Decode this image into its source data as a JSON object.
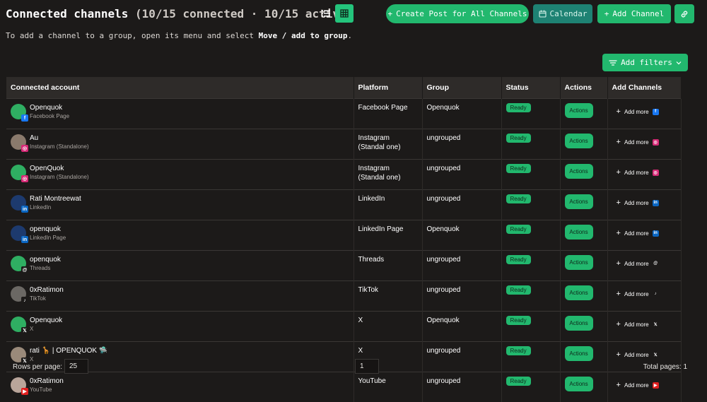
{
  "header": {
    "title": "Connected channels",
    "counts": "(10/15 connected · 10/15 active)",
    "create_post_label": "Create Post for All Channels",
    "calendar_label": "Calendar",
    "add_channel_label": "Add Channel"
  },
  "hint": {
    "prefix": "To add a channel to a group, open its menu and select ",
    "emphasis": "Move / add to group",
    "suffix": "."
  },
  "filters": {
    "label": "Add filters"
  },
  "table": {
    "columns": [
      "Connected account",
      "Platform",
      "Group",
      "Status",
      "Actions",
      "Add Channels"
    ],
    "rows": [
      {
        "name": "Openquok",
        "sub": "Facebook Page",
        "platform": "Facebook Page",
        "group": "Openquok",
        "status": "Ready",
        "action": "Actions",
        "add": "Add more",
        "platform_icon": "facebook-icon"
      },
      {
        "name": "Au",
        "sub": "Instagram (Standalone)",
        "platform": "Instagram (Standal one)",
        "group": "ungrouped",
        "status": "Ready",
        "action": "Actions",
        "add": "Add more",
        "platform_icon": "instagram-icon"
      },
      {
        "name": "OpenQuok",
        "sub": "Instagram (Standalone)",
        "platform": "Instagram (Standal one)",
        "group": "ungrouped",
        "status": "Ready",
        "action": "Actions",
        "add": "Add more",
        "platform_icon": "instagram-icon"
      },
      {
        "name": "Rati Montreewat",
        "sub": "LinkedIn",
        "platform": "LinkedIn",
        "group": "ungrouped",
        "status": "Ready",
        "action": "Actions",
        "add": "Add more",
        "platform_icon": "linkedin-icon"
      },
      {
        "name": "openquok",
        "sub": "LinkedIn Page",
        "platform": "LinkedIn Page",
        "group": "Openquok",
        "status": "Ready",
        "action": "Actions",
        "add": "Add more",
        "platform_icon": "linkedin-icon"
      },
      {
        "name": "openquok",
        "sub": "Threads",
        "platform": "Threads",
        "group": "ungrouped",
        "status": "Ready",
        "action": "Actions",
        "add": "Add more",
        "platform_icon": "threads-icon"
      },
      {
        "name": "0xRatimon",
        "sub": "TikTok",
        "platform": "TikTok",
        "group": "ungrouped",
        "status": "Ready",
        "action": "Actions",
        "add": "Add more",
        "platform_icon": "tiktok-icon"
      },
      {
        "name": "Openquok",
        "sub": "X",
        "platform": "X",
        "group": "Openquok",
        "status": "Ready",
        "action": "Actions",
        "add": "Add more",
        "platform_icon": "x-icon"
      },
      {
        "name": "rati 🦒 | OPENQUOK 🛸",
        "sub": "X",
        "platform": "X",
        "group": "ungrouped",
        "status": "Ready",
        "action": "Actions",
        "add": "Add more",
        "platform_icon": "x-icon"
      },
      {
        "name": "0xRatimon",
        "sub": "YouTube",
        "platform": "YouTube",
        "group": "ungrouped",
        "status": "Ready",
        "action": "Actions",
        "add": "Add more",
        "platform_icon": "youtube-icon"
      }
    ]
  },
  "footer": {
    "rows_per_page_label": "Rows per page:",
    "rows_per_page_value": "25",
    "page_value": "1",
    "total_pages": "Total pages: 1"
  },
  "colors": {
    "accent": "#22b86e",
    "background": "#1c1a19",
    "header_row": "#2e2b29"
  }
}
